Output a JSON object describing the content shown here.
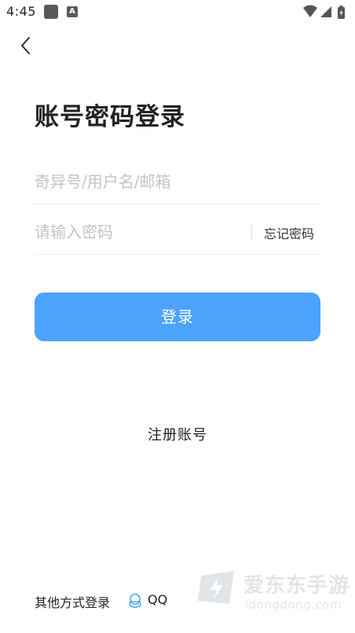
{
  "status_bar": {
    "time": "4:45",
    "icons": [
      "app-icon",
      "font-a-icon",
      "wifi-icon",
      "signal-icon",
      "battery-charging-icon"
    ],
    "a_badge": "A"
  },
  "header": {
    "back_icon": "chevron-left-icon"
  },
  "page": {
    "title": "账号密码登录"
  },
  "form": {
    "username_placeholder": "奇异号/用户名/邮箱",
    "username_value": "",
    "password_placeholder": "请输入密码",
    "password_value": "",
    "forgot_password": "忘记密码",
    "login_button": "登录"
  },
  "register": {
    "label": "注册账号"
  },
  "other_login": {
    "label": "其他方式登录",
    "qq_label": "QQ",
    "qq_icon": "qq-icon"
  },
  "watermark": {
    "cn": "爱东东手游",
    "en": "idongdong.com"
  },
  "colors": {
    "primary": "#4ba3fb",
    "text": "#222222",
    "placeholder": "#c4c4c4",
    "divider": "#ececec"
  }
}
